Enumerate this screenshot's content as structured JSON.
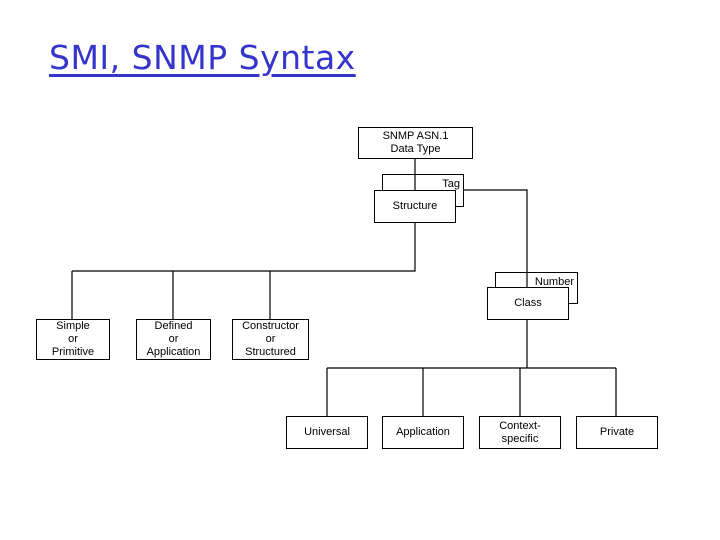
{
  "title": "SMI, SNMP Syntax",
  "colors": {
    "title": "#3535cc",
    "lines": "#000000",
    "box_border": "#000000"
  },
  "diagram": {
    "root": "SNMP ASN.1\nData Type",
    "tag": "Tag",
    "structure": "Structure",
    "number": "Number",
    "class": "Class",
    "structure_children": [
      "Simple\nor\nPrimitive",
      "Defined\nor\nApplication",
      "Constructor\nor\nStructured"
    ],
    "class_children": [
      "Universal",
      "Application",
      "Context-\nspecific",
      "Private"
    ]
  }
}
